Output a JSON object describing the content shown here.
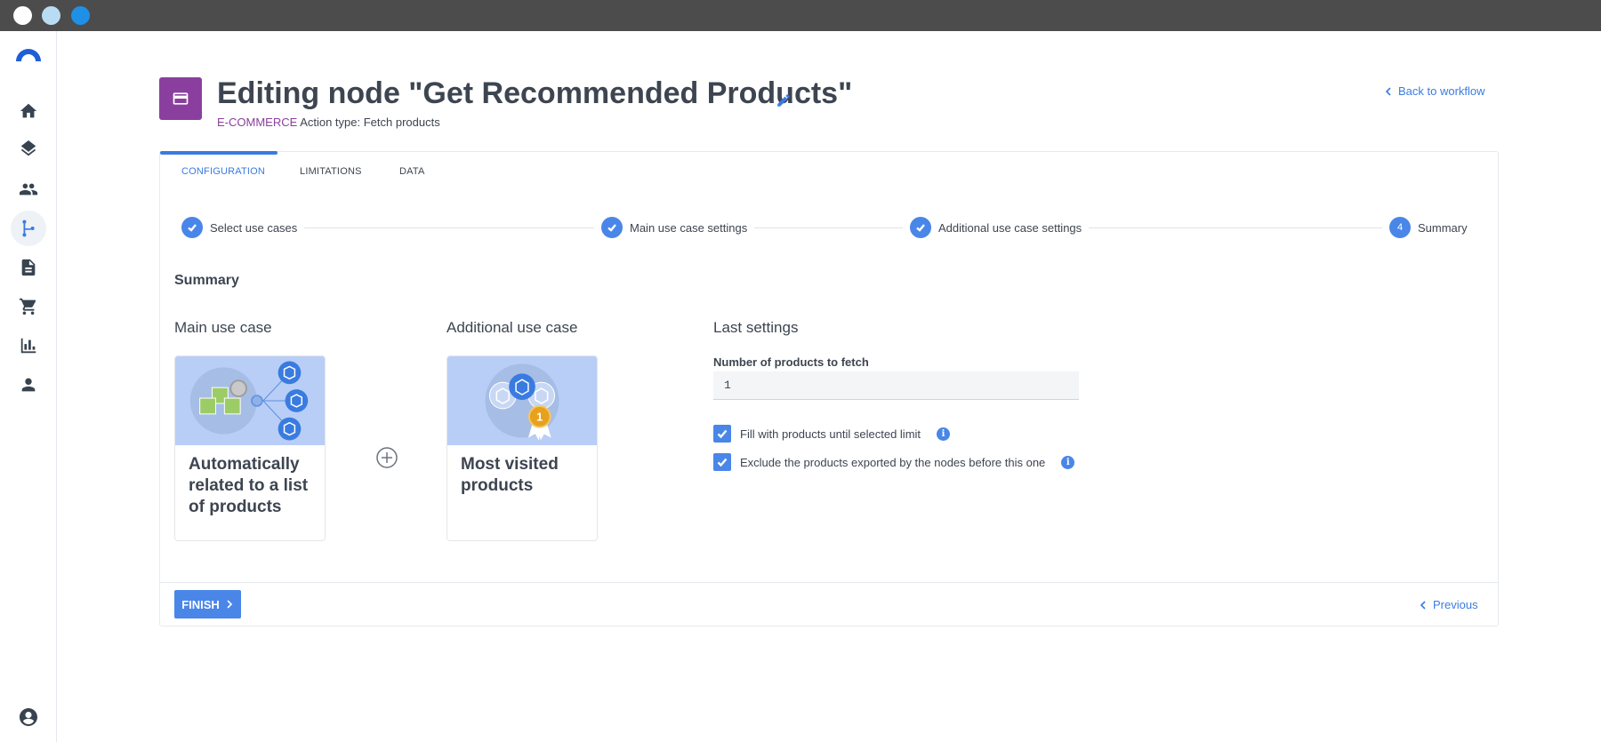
{
  "window": {
    "controls": [
      "close",
      "minimize",
      "maximize"
    ]
  },
  "sidebar": {
    "logo": "brand-logo",
    "items": [
      {
        "name": "home-icon"
      },
      {
        "name": "layers-icon"
      },
      {
        "name": "people-icon"
      },
      {
        "name": "workflow-icon",
        "active": true
      },
      {
        "name": "document-icon"
      },
      {
        "name": "cart-icon"
      },
      {
        "name": "analytics-icon"
      },
      {
        "name": "person-icon"
      }
    ],
    "footer_icon": "account-circle-icon"
  },
  "header": {
    "icon": "card-icon",
    "title": "Editing node \"Get Recommended Products\"",
    "category": "E-COMMERCE",
    "action_type": "Action type: Fetch products",
    "back_link": "Back to workflow"
  },
  "tabs": [
    {
      "label": "CONFIGURATION",
      "active": true
    },
    {
      "label": "LIMITATIONS"
    },
    {
      "label": "DATA"
    }
  ],
  "stepper": {
    "steps": [
      {
        "label": "Select use cases",
        "status": "done"
      },
      {
        "label": "Main use case settings",
        "status": "done"
      },
      {
        "label": "Additional use case settings",
        "status": "done"
      },
      {
        "label": "Summary",
        "status": "current",
        "number": "4"
      }
    ]
  },
  "summary": {
    "section_title": "Summary",
    "main_use_case": {
      "heading": "Main use case",
      "title": "Automatically related to a list of products"
    },
    "additional_use_case": {
      "heading": "Additional use case",
      "title": "Most visited products"
    },
    "last_settings": {
      "heading": "Last settings",
      "field_label": "Number of products to fetch",
      "field_value": "1",
      "checkboxes": [
        {
          "label": "Fill with products until selected limit",
          "checked": true
        },
        {
          "label": "Exclude the products exported by the nodes before this one",
          "checked": true
        }
      ]
    }
  },
  "footer": {
    "finish_label": "FINISH",
    "previous_label": "Previous"
  },
  "colors": {
    "accent": "#4a86e8",
    "category": "#8a3f9e",
    "titlebar": "#4c4c4c"
  }
}
